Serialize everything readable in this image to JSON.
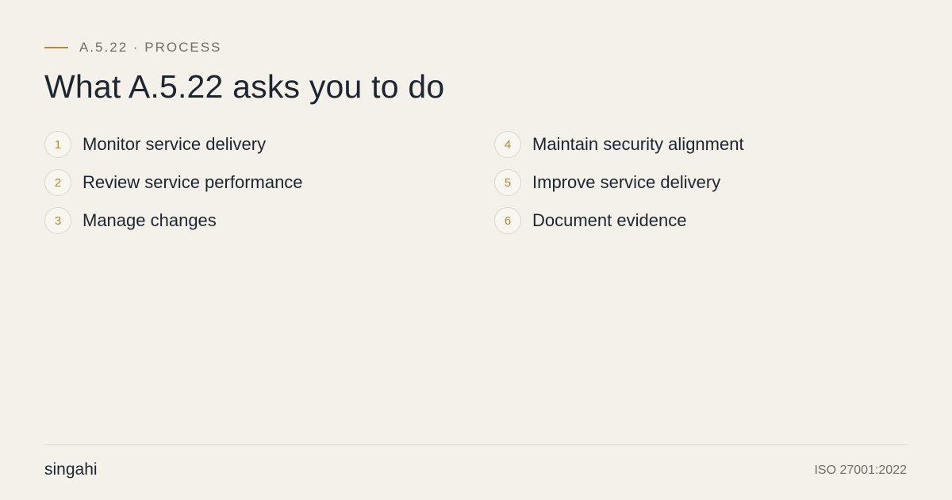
{
  "eyebrow": {
    "label": "A.5.22 · PROCESS",
    "accent_color": "#b8892e"
  },
  "title": "What A.5.22 asks you to do",
  "steps_left": [
    {
      "number": "1",
      "label": "Monitor service delivery"
    },
    {
      "number": "2",
      "label": "Review service performance"
    },
    {
      "number": "3",
      "label": "Manage changes"
    }
  ],
  "steps_right": [
    {
      "number": "4",
      "label": "Maintain security alignment"
    },
    {
      "number": "5",
      "label": "Improve service delivery"
    },
    {
      "number": "6",
      "label": "Document evidence"
    }
  ],
  "footer": {
    "brand": "singahi",
    "standard": "ISO 27001:2022"
  },
  "colors": {
    "background": "#f4f1eb",
    "text": "#1c2530",
    "muted": "#6f6f6c",
    "accent": "#b8892e"
  }
}
